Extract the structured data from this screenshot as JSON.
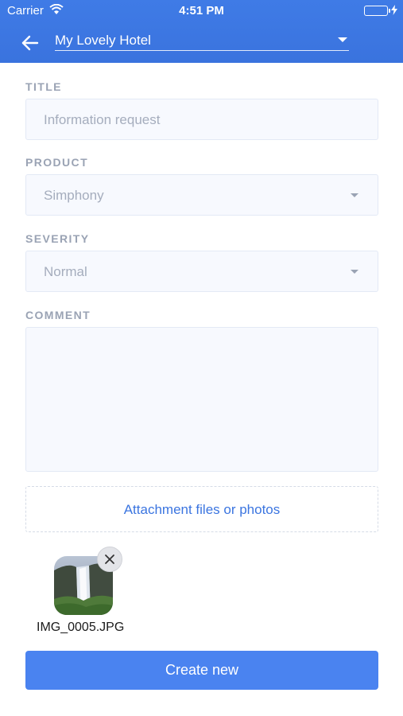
{
  "status_bar": {
    "carrier": "Carrier",
    "time": "4:51 PM"
  },
  "header": {
    "hotel_name": "My Lovely Hotel",
    "back_icon": "arrow-left-icon",
    "dropdown_icon": "caret-down-icon"
  },
  "form": {
    "title": {
      "label": "TITLE",
      "placeholder": "Information request"
    },
    "product": {
      "label": "PRODUCT",
      "value": "Simphony"
    },
    "severity": {
      "label": "SEVERITY",
      "value": "Normal"
    },
    "comment": {
      "label": "COMMENT",
      "value": ""
    }
  },
  "attachment": {
    "label": "Attachment files or photos",
    "files": [
      {
        "name": "IMG_0005.JPG"
      }
    ]
  },
  "actions": {
    "create_label": "Create new"
  },
  "colors": {
    "header": "#3d78e3",
    "accent": "#4a83f0",
    "link": "#3b75e0"
  }
}
